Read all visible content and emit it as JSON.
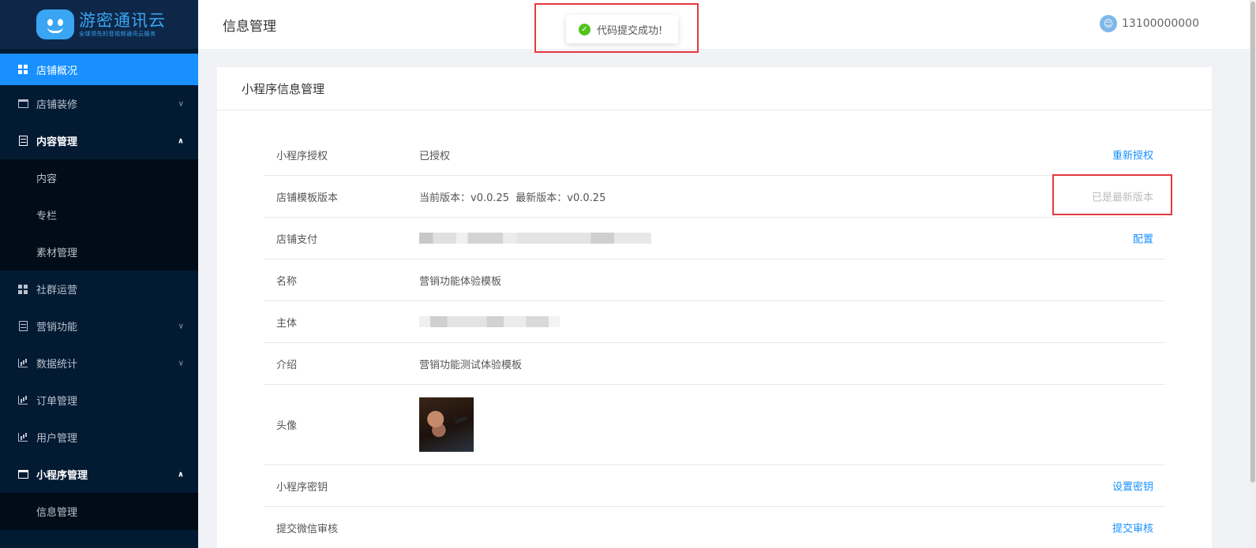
{
  "brand": {
    "title": "游密通讯云",
    "subtitle": "全球领先的音视频通讯云服务"
  },
  "header": {
    "page_title": "信息管理",
    "user_phone": "13100000000"
  },
  "toast": {
    "message": "代码提交成功!"
  },
  "sidebar": {
    "items": [
      {
        "label": "店铺概况"
      },
      {
        "label": "店铺装修"
      },
      {
        "label": "内容管理"
      },
      {
        "label": "内容"
      },
      {
        "label": "专栏"
      },
      {
        "label": "素材管理"
      },
      {
        "label": "社群运营"
      },
      {
        "label": "营销功能"
      },
      {
        "label": "数据统计"
      },
      {
        "label": "订单管理"
      },
      {
        "label": "用户管理"
      },
      {
        "label": "小程序管理"
      },
      {
        "label": "信息管理"
      }
    ]
  },
  "card": {
    "title": "小程序信息管理",
    "rows": [
      {
        "label": "小程序授权",
        "value": "已授权",
        "action": "重新授权"
      },
      {
        "label": "店铺模板版本",
        "value": "当前版本：v0.0.25  最新版本：v0.0.25",
        "action": "已是最新版本"
      },
      {
        "label": "店铺支付",
        "action": "配置"
      },
      {
        "label": "名称",
        "value": "营销功能体验模板"
      },
      {
        "label": "主体"
      },
      {
        "label": "介绍",
        "value": "营销功能测试体验模板"
      },
      {
        "label": "头像"
      },
      {
        "label": "小程序密钥",
        "action": "设置密钥"
      },
      {
        "label": "提交微信审核",
        "action": "提交审核"
      }
    ]
  },
  "colors": {
    "sidebar_bg": "#031a33",
    "accent": "#1890ff",
    "success": "#52c41a",
    "highlight": "#e5393d"
  }
}
